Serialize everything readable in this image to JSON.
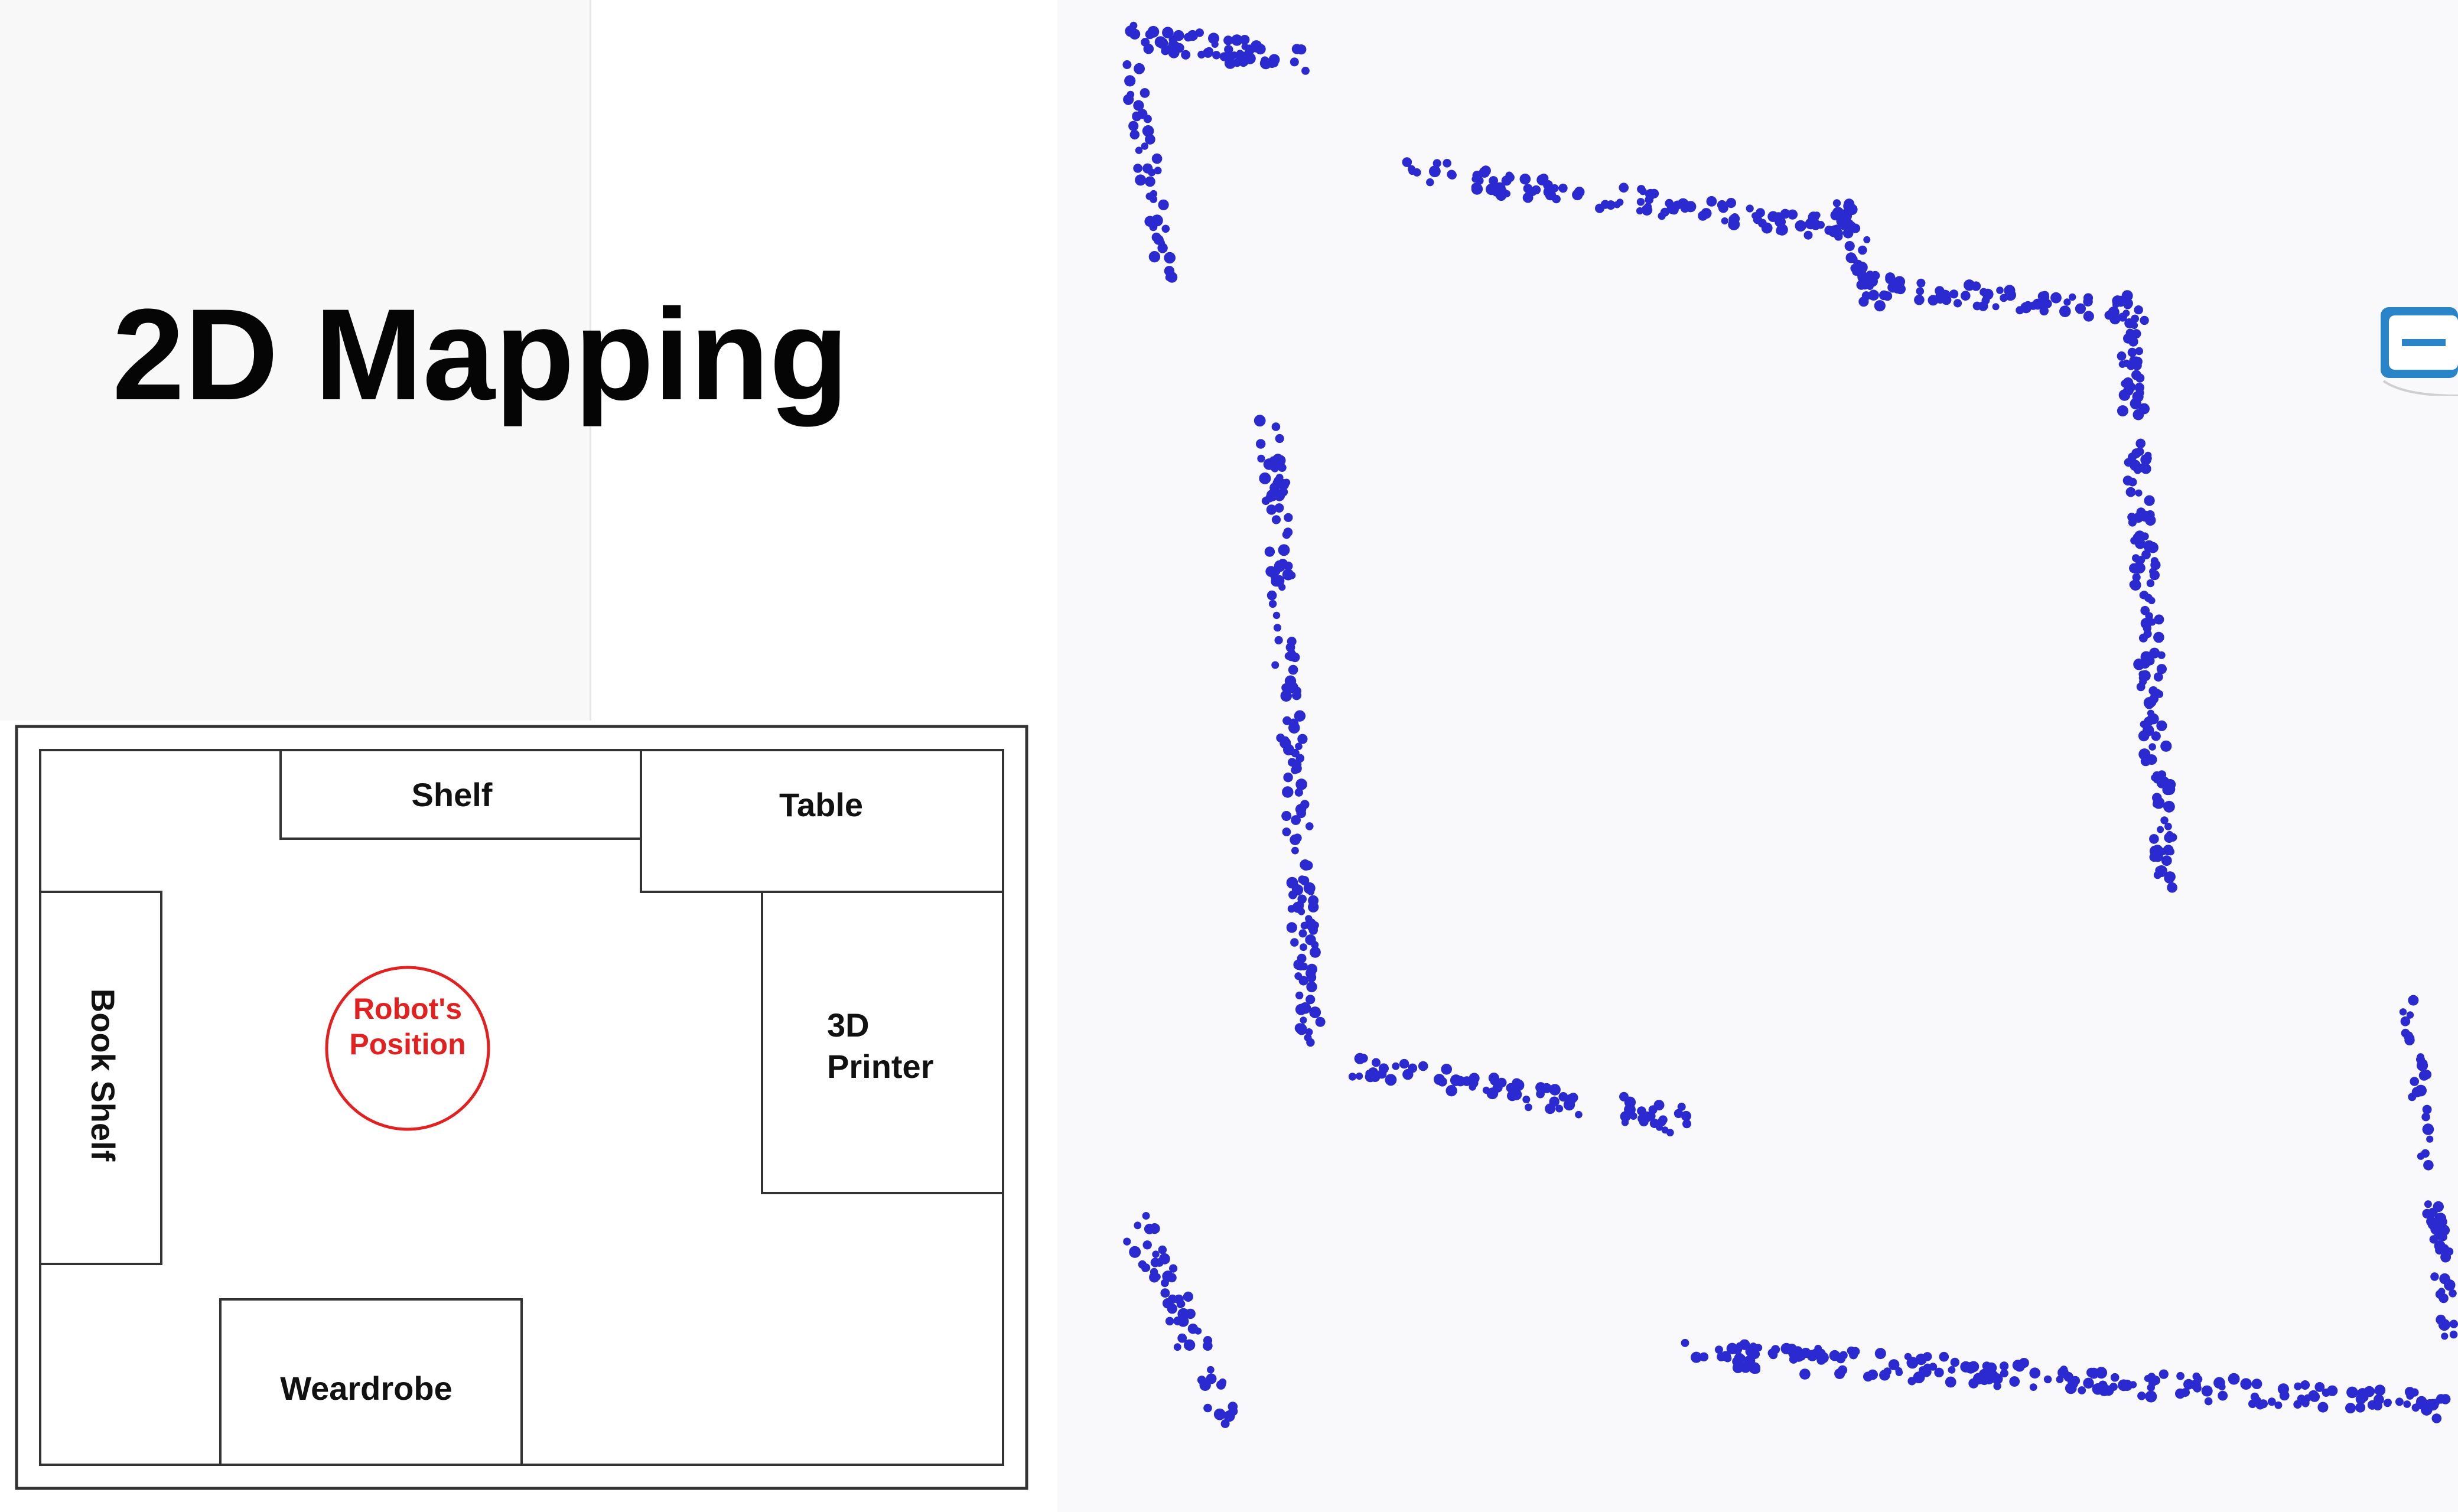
{
  "title": "2D Mapping",
  "floor_plan": {
    "labels": {
      "shelf": "Shelf",
      "table": "Table",
      "book_shelf": "Book Shelf",
      "printer_line1": "3D",
      "printer_line2": "Printer",
      "wardrobe": "Weardrobe"
    },
    "robot": {
      "line1": "Robot's",
      "line2": "Position",
      "color": "#e32020"
    }
  },
  "scan_map": {
    "point_color": "#2a2ad0"
  },
  "icon": "device-icon"
}
